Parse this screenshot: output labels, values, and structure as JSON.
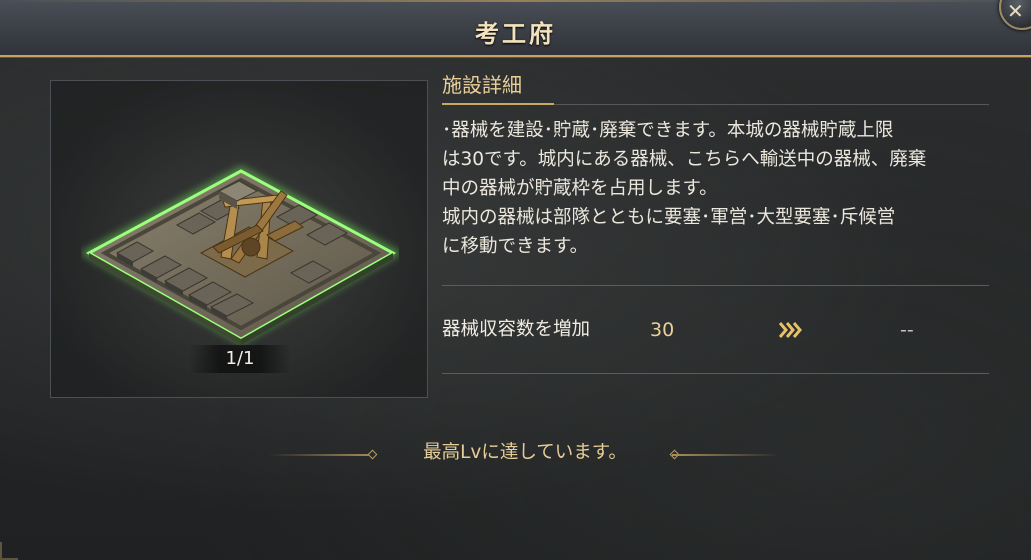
{
  "window": {
    "title": "考工府",
    "close_icon": "close-icon"
  },
  "image_panel": {
    "page_indicator": "1/1",
    "image": "siege-workshop-building"
  },
  "details": {
    "heading": "施設詳細",
    "description_lines": [
      "･器械を建設･貯蔵･廃棄できます。本城の器械貯蔵上限",
      "は30です。城内にある器械、こちらへ輸送中の器械、廃棄",
      "中の器械が貯蔵枠を占用します。",
      "城内の器械は部隊とともに要塞･軍営･大型要塞･斥候営",
      "に移動できます。"
    ]
  },
  "stat": {
    "label": "器械収容数を増加",
    "current": "30",
    "arrow_icon": "triple-chevron-right-icon",
    "next": "--"
  },
  "footer": {
    "max_level_text": "最高Lvに達しています。"
  },
  "colors": {
    "gold_accent": "#c9a862",
    "text_gold": "#e9cf98",
    "highlight_green": "#7fe06a",
    "background": "#262829"
  }
}
